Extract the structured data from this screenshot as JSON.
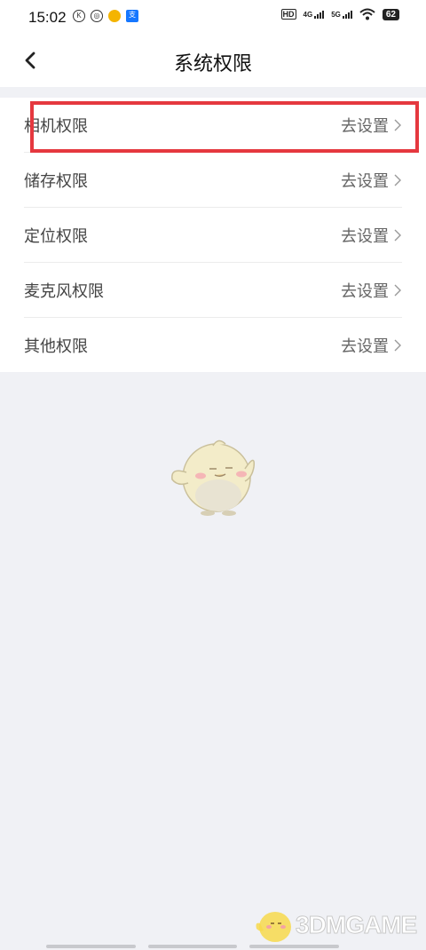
{
  "status_bar": {
    "time": "15:02",
    "hd_label": "HD",
    "net1_label": "4G",
    "net2_label": "5G",
    "battery": "62"
  },
  "header": {
    "title": "系统权限"
  },
  "permissions": [
    {
      "label": "相机权限",
      "action": "去设置"
    },
    {
      "label": "储存权限",
      "action": "去设置"
    },
    {
      "label": "定位权限",
      "action": "去设置"
    },
    {
      "label": "麦克风权限",
      "action": "去设置"
    },
    {
      "label": "其他权限",
      "action": "去设置"
    }
  ],
  "watermark": {
    "text": "3DMGAME"
  },
  "colors": {
    "background": "#f0f1f5",
    "highlight": "#e5383f"
  }
}
